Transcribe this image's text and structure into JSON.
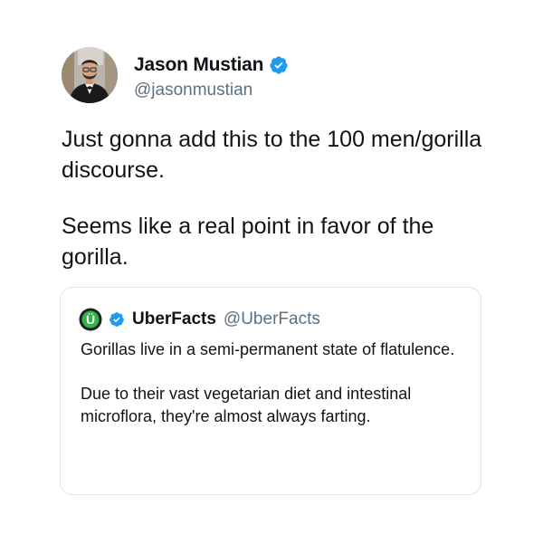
{
  "tweet": {
    "author": {
      "display_name": "Jason Mustian",
      "handle": "@jasonmustian",
      "verified": true,
      "avatar_icon": "profile-photo"
    },
    "text_paragraphs": [
      "Just gonna add this to the 100 men/gorilla discourse.",
      "Seems like a real point in favor of the gorilla."
    ]
  },
  "quoted_tweet": {
    "author": {
      "display_name": "UberFacts",
      "handle": "@UberFacts",
      "verified": true,
      "avatar_icon": "uberfacts-logo",
      "avatar_letter": "Ü"
    },
    "text_paragraphs": [
      "Gorillas live in a semi-permanent state of flatulence.",
      "Due to their vast vegetarian diet and intestinal microflora, they're almost always farting."
    ]
  },
  "colors": {
    "verified_blue": "#1d9bf0",
    "handle_gray": "#5b7083",
    "text": "#0f1419",
    "card_border": "#e1e6ea",
    "uberfacts_green": "#2fb44a"
  }
}
